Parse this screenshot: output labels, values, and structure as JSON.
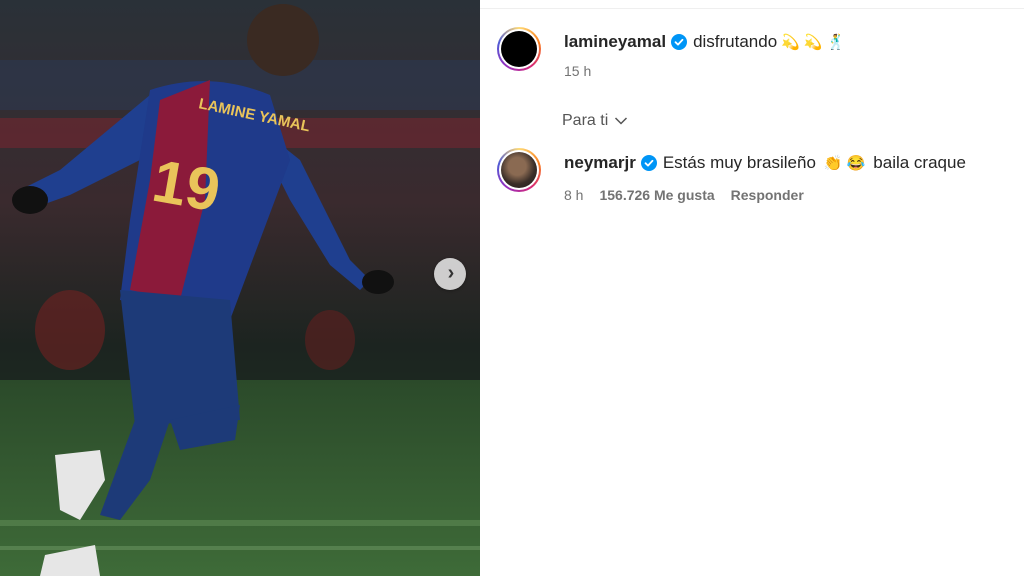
{
  "post": {
    "author": "lamineyamal",
    "caption": "disfrutando",
    "caption_emojis": [
      "💫",
      "💫",
      "🕺"
    ],
    "time": "15 h",
    "jersey_name": "LAMINE YAMAL",
    "jersey_number": "19"
  },
  "sort": {
    "label": "Para ti"
  },
  "comment": {
    "author": "neymarjr",
    "text_a": "Estás muy brasileño",
    "emojis": [
      "👏",
      "😂"
    ],
    "text_b": "baila craque",
    "time": "8 h",
    "likes": "156.726 Me gusta",
    "reply": "Responder"
  },
  "icons": {
    "verified": "verified-badge-icon",
    "chevron": "chevron-down-icon",
    "next": "chevron-right-icon"
  },
  "colors": {
    "verified": "#0095f6",
    "text": "#262626",
    "muted": "#737373"
  }
}
